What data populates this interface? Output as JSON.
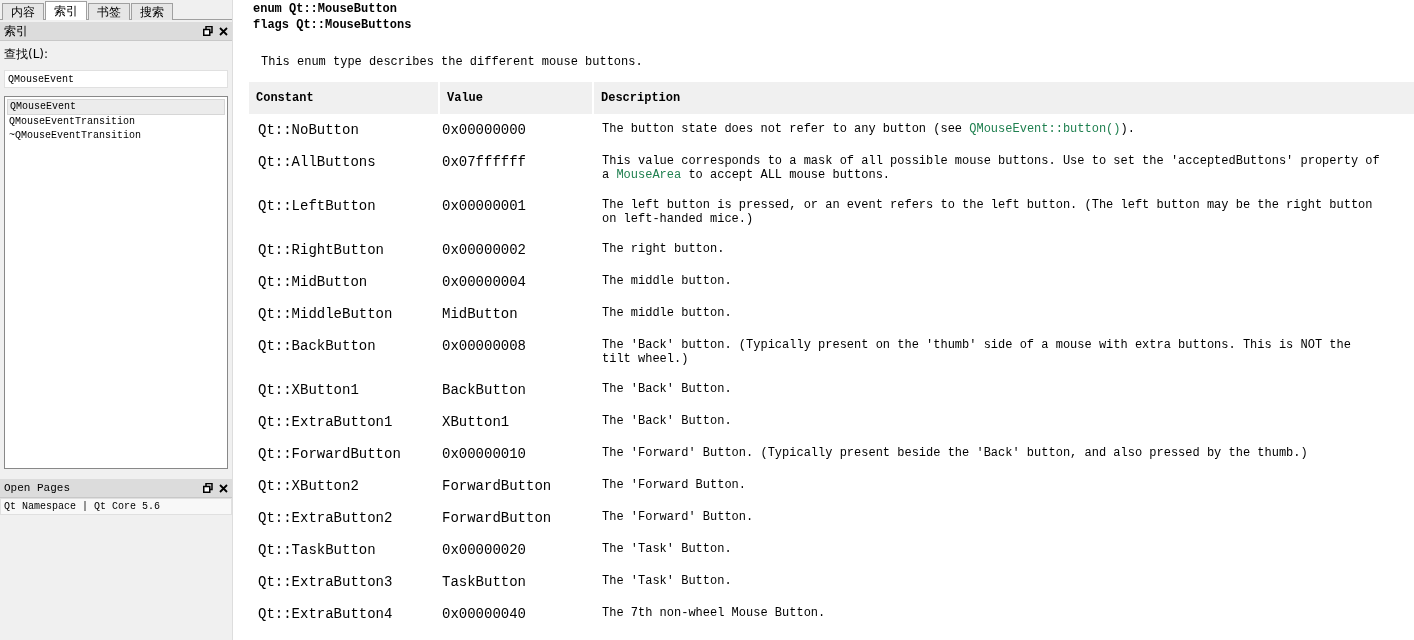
{
  "sidebar": {
    "tabs": [
      {
        "label": "内容",
        "selected": false
      },
      {
        "label": "索引",
        "selected": true
      },
      {
        "label": "书签",
        "selected": false
      },
      {
        "label": "搜索",
        "selected": false
      }
    ],
    "index_panel": {
      "title": "索引",
      "find_label": "查找(L):",
      "search": {
        "value": "QMouseEvent"
      },
      "results": [
        {
          "label": "QMouseEvent",
          "selected": true
        },
        {
          "label": "QMouseEventTransition",
          "selected": false
        },
        {
          "label": "~QMouseEventTransition",
          "selected": false
        }
      ]
    },
    "open_pages_panel": {
      "title": "Open Pages",
      "pages": [
        {
          "label": "Qt Namespace | Qt Core 5.6",
          "selected": true
        }
      ]
    }
  },
  "document": {
    "headings": [
      "enum Qt::MouseButton",
      "flags Qt::MouseButtons"
    ],
    "intro": "This enum type describes the different mouse buttons.",
    "table": {
      "columns": [
        "Constant",
        "Value",
        "Description"
      ],
      "rows": [
        {
          "constant": "Qt::NoButton",
          "value": "0x00000000",
          "description": [
            {
              "text": "The button state does not refer to any button (see "
            },
            {
              "text": "QMouseEvent::button()",
              "kind": "link"
            },
            {
              "text": ")."
            }
          ]
        },
        {
          "constant": "Qt::AllButtons",
          "value": "0x07ffffff",
          "description": [
            {
              "text": "This value corresponds to a mask of all possible mouse buttons. Use to set the 'acceptedButtons' property of a "
            },
            {
              "text": "MouseArea",
              "kind": "link"
            },
            {
              "text": " to accept ALL mouse buttons."
            }
          ]
        },
        {
          "constant": "Qt::LeftButton",
          "value": "0x00000001",
          "description": [
            {
              "text": "The left button is pressed, or an event refers to the left button. (The left button may be the right button on left-handed mice.)"
            }
          ]
        },
        {
          "constant": "Qt::RightButton",
          "value": "0x00000002",
          "description": [
            {
              "text": "The right button."
            }
          ]
        },
        {
          "constant": "Qt::MidButton",
          "value": "0x00000004",
          "description": [
            {
              "text": "The middle button."
            }
          ]
        },
        {
          "constant": "Qt::MiddleButton",
          "value": "MidButton",
          "description": [
            {
              "text": "The middle button."
            }
          ]
        },
        {
          "constant": "Qt::BackButton",
          "value": "0x00000008",
          "description": [
            {
              "text": "The 'Back' button. (Typically present on the 'thumb' side of a mouse with extra buttons. This is NOT the tilt wheel.)"
            }
          ]
        },
        {
          "constant": "Qt::XButton1",
          "value": "BackButton",
          "description": [
            {
              "text": "The 'Back' Button."
            }
          ]
        },
        {
          "constant": "Qt::ExtraButton1",
          "value": "XButton1",
          "description": [
            {
              "text": "The 'Back' Button."
            }
          ]
        },
        {
          "constant": "Qt::ForwardButton",
          "value": "0x00000010",
          "description": [
            {
              "text": "The 'Forward' Button. (Typically present beside the 'Back' button, and also pressed by the thumb.)"
            }
          ]
        },
        {
          "constant": "Qt::XButton2",
          "value": "ForwardButton",
          "description": [
            {
              "text": "The 'Forward Button."
            }
          ]
        },
        {
          "constant": "Qt::ExtraButton2",
          "value": "ForwardButton",
          "description": [
            {
              "text": "The 'Forward' Button."
            }
          ]
        },
        {
          "constant": "Qt::TaskButton",
          "value": "0x00000020",
          "description": [
            {
              "text": "The 'Task' Button."
            }
          ]
        },
        {
          "constant": "Qt::ExtraButton3",
          "value": "TaskButton",
          "description": [
            {
              "text": "The 'Task' Button."
            }
          ]
        },
        {
          "constant": "Qt::ExtraButton4",
          "value": "0x00000040",
          "description": [
            {
              "text": "The 7th non-wheel Mouse Button."
            }
          ]
        }
      ]
    }
  }
}
